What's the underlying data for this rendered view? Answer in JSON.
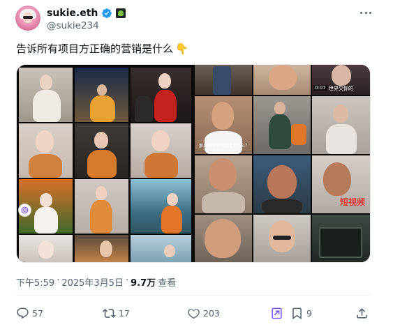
{
  "author": {
    "display_name": "sukie.eth",
    "handle": "@sukie234",
    "verified_color": "#1d9bf0"
  },
  "tweet": {
    "text": "告诉所有项目方正确的营销是什么",
    "emoji": "👇"
  },
  "media": {
    "right_captions": {
      "top_right_caption": "世界欠你的",
      "top_right_time": "0:07",
      "mid_caption": "那么小时候你想成为什么？",
      "red_label": "短视频"
    }
  },
  "meta": {
    "time": "下午5:59",
    "dot1": "·",
    "date": "2025年3月5日",
    "dot2": "·",
    "views_count": "9.7万",
    "views_label": "查看"
  },
  "actions": {
    "reply_count": "57",
    "retweet_count": "17",
    "like_count": "203",
    "bookmark_count": "9"
  },
  "colors": {
    "text_primary": "#0f1419",
    "text_secondary": "#536471",
    "accent": "#1d9bf0",
    "grok_purple": "#7856ff"
  },
  "icons": {
    "more": "more-dots-icon",
    "reply": "reply-icon",
    "retweet": "retweet-icon",
    "like": "heart-icon",
    "grok": "grok-icon",
    "bookmark": "bookmark-icon",
    "share": "share-icon"
  }
}
